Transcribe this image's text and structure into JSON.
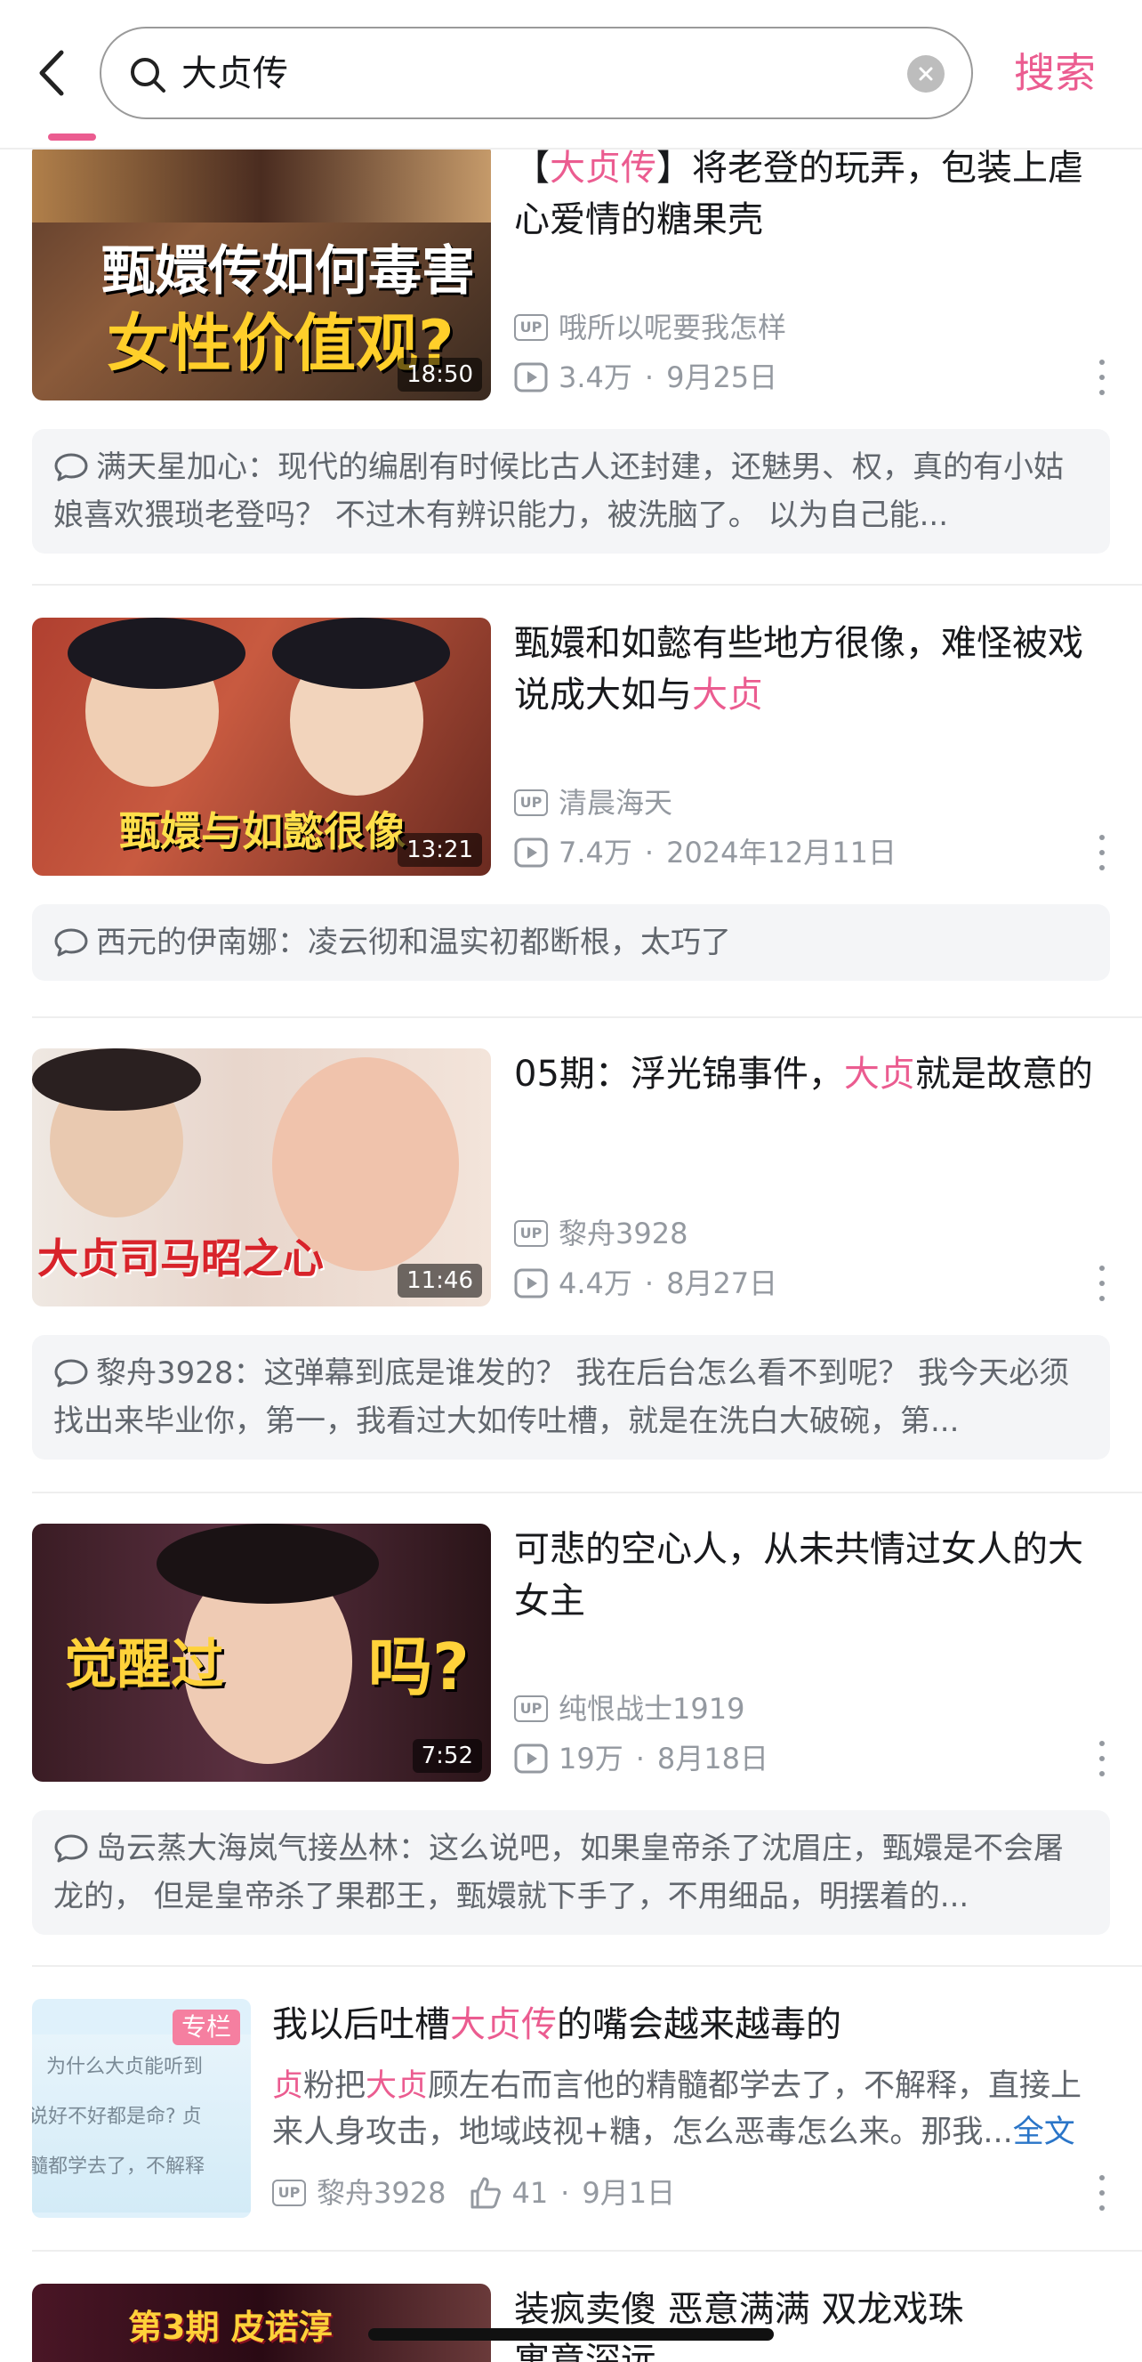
{
  "search": {
    "query": "大贞传",
    "button_label": "搜索"
  },
  "videos": [
    {
      "title_parts": [
        "【",
        "大贞传",
        "】将老登的玩弄，包装上虐心爱情的糖果壳"
      ],
      "uploader": "哦所以呢要我怎样",
      "views": "3.4万",
      "date": "9月25日",
      "duration": "18:50",
      "thumb_text": [
        "甄嬛传如何毒害",
        "女性价值观?"
      ],
      "comment": "满天星加心：现代的编剧有时候比古人还封建，还魅男、权，真的有小姑娘喜欢猥琐老登吗？ 不过木有辨识能力，被洗脑了。 以为自己能..."
    },
    {
      "title_parts": [
        "甄嬛和如懿有些地方很像，难怪被戏说成大如与",
        "大贞",
        ""
      ],
      "uploader": "清晨海天",
      "views": "7.4万",
      "date": "2024年12月11日",
      "duration": "13:21",
      "thumb_text": [
        "甄嬛与如懿很像"
      ],
      "comment": "西元的伊南娜：凌云彻和温实初都断根，太巧了"
    },
    {
      "title_parts": [
        "05期：浮光锦事件，",
        "大贞",
        "就是故意的"
      ],
      "uploader": "黎舟3928",
      "views": "4.4万",
      "date": "8月27日",
      "duration": "11:46",
      "thumb_text": [
        "大贞司马昭之心"
      ],
      "comment": "黎舟3928：这弹幕到底是谁发的？ 我在后台怎么看不到呢？ 我今天必须找出来毕业你，第一，我看过大如传吐槽，就是在洗白大破碗，第..."
    },
    {
      "title_parts": [
        "可悲的空心人，从未共情过女人的大女主",
        "",
        ""
      ],
      "uploader": "纯恨战士1919",
      "views": "19万",
      "date": "8月18日",
      "duration": "7:52",
      "thumb_text": [
        "觉醒过",
        "吗?"
      ],
      "comment": "岛云蒸大海岚气接丛林：这么说吧，如果皇帝杀了沈眉庄，甄嬛是不会屠龙的， 但是皇帝杀了果郡王，甄嬛就下手了，不用细品，明摆着的..."
    }
  ],
  "column_article": {
    "badge": "专栏",
    "title_parts": [
      "我以后吐槽",
      "大贞传",
      "的嘴会越来越毒的"
    ],
    "summary_parts": [
      "贞",
      "粉把",
      "大贞",
      "顾左右而言他的精髓都学去了，不解释，直接上来人身攻击，地域歧视+糖，怎么恶毒怎么来。那我..."
    ],
    "full_text_link": "全文",
    "thumb_lines": [
      "为什么大贞能听到",
      "说好不好都是命?  贞",
      "髓都学去了，不解释"
    ],
    "author": "黎舟3928",
    "likes": "41",
    "date": "9月1日"
  },
  "partial_card": {
    "title_line1": "装疯卖傻 恶意满满 双龙戏珠",
    "title_line2": "寓意深远",
    "thumb_text": "第3期  皮诺淳"
  },
  "colors": {
    "accent": "#eb5c90",
    "meta": "#9499a0",
    "comment_bg": "#f4f5f7",
    "link": "#2a75c8"
  },
  "icons": [
    "back-arrow-icon",
    "search-icon",
    "clear-icon",
    "up-badge-icon",
    "play-count-icon",
    "more-icon",
    "comment-bubble-icon",
    "like-icon"
  ]
}
